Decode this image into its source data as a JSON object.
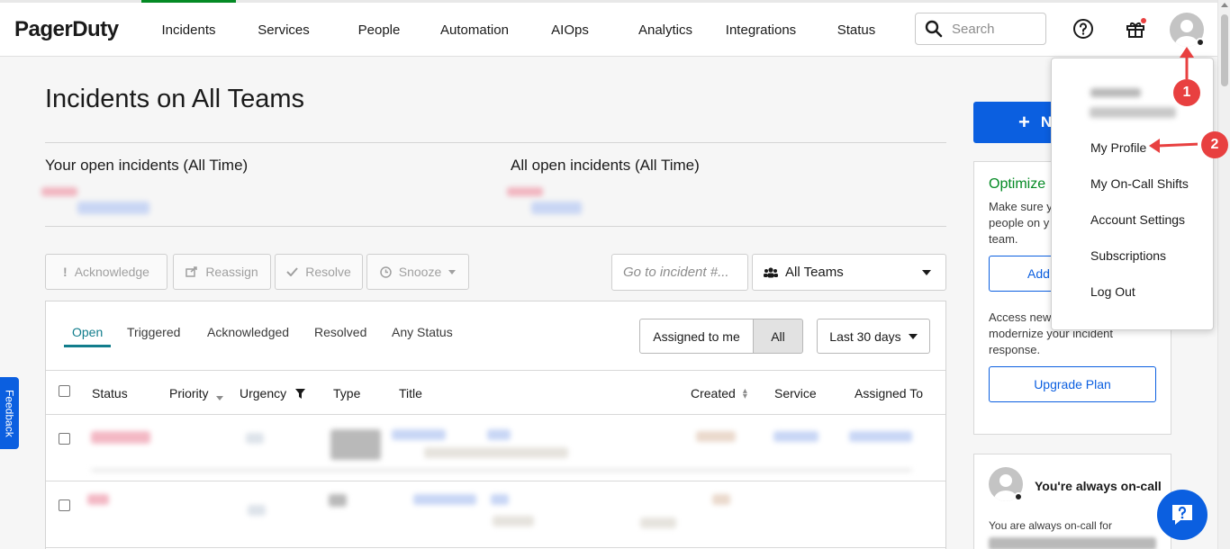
{
  "brand": {
    "name": "PagerDuty"
  },
  "nav": {
    "items": [
      {
        "label": "Incidents",
        "active": true
      },
      {
        "label": "Services"
      },
      {
        "label": "People"
      },
      {
        "label": "Automation"
      },
      {
        "label": "AIOps"
      },
      {
        "label": "Analytics"
      },
      {
        "label": "Integrations"
      },
      {
        "label": "Status"
      }
    ],
    "search_placeholder": "Search"
  },
  "page": {
    "title": "Incidents on All Teams",
    "your_open_label": "Your open incidents (All Time)",
    "all_open_label": "All open incidents (All Time)"
  },
  "actions": {
    "acknowledge": "Acknowledge",
    "reassign": "Reassign",
    "resolve": "Resolve",
    "snooze": "Snooze",
    "goto_placeholder": "Go to incident #...",
    "teams": "All Teams"
  },
  "tabs": [
    "Open",
    "Triggered",
    "Acknowledged",
    "Resolved",
    "Any Status"
  ],
  "filters": {
    "assigned_to_me": "Assigned to me",
    "all": "All",
    "range": "Last 30 days"
  },
  "table": {
    "headers": [
      "Status",
      "Priority",
      "Urgency",
      "Type",
      "Title",
      "Created",
      "Service",
      "Assigned To"
    ]
  },
  "sidebar": {
    "new_incident": "N",
    "optimize_title": "Optimize",
    "optimize_text": "Make sure y\npeople on y\nteam.",
    "add_button": "Add",
    "access_text": "Access new\nmodernize your incident\nresponse.",
    "upgrade": "Upgrade Plan",
    "oncall_title": "You're always on-call",
    "oncall_text": "You are always on-call for"
  },
  "user_menu": {
    "items": [
      "My Profile",
      "My On-Call Shifts",
      "Account Settings",
      "Subscriptions",
      "Log Out"
    ]
  },
  "annotations": {
    "step1": "1",
    "step2": "2"
  },
  "feedback": "Feedback",
  "colors": {
    "accent": "#0b5fe0",
    "brand_green": "#048a24",
    "tab_teal": "#117d8c",
    "annotation_red": "#e84040"
  }
}
